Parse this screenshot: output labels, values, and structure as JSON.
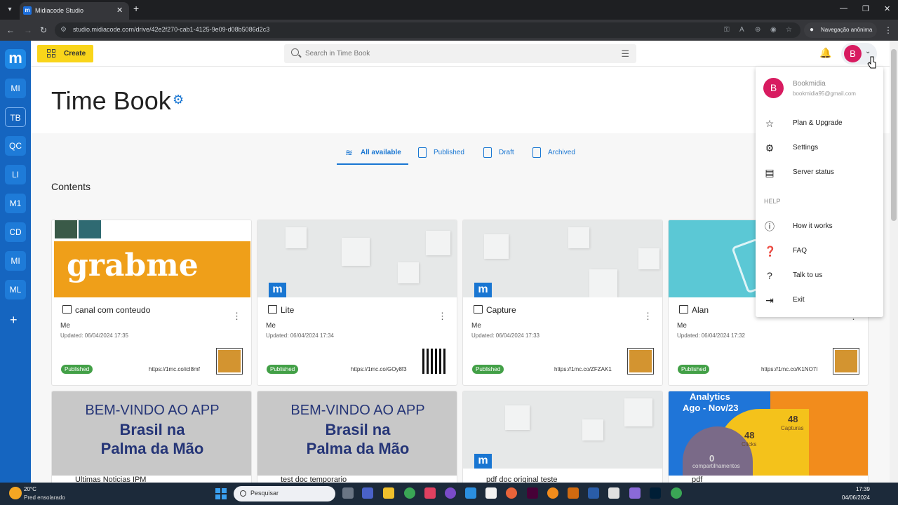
{
  "browser": {
    "tab_title": "Midiacode Studio",
    "url": "studio.midiacode.com/drive/42e2f270-cab1-4125-9e09-d08b5086d2c3",
    "incognito_label": "Navegação anônima"
  },
  "rail": {
    "logo": "m",
    "workspaces": [
      "MI",
      "TB",
      "QC",
      "LI",
      "M1",
      "CD",
      "MI",
      "ML"
    ],
    "add": "+"
  },
  "header": {
    "create_label": "Create",
    "search_placeholder": "Search in Time Book",
    "avatar_letter": "B"
  },
  "page": {
    "title": "Time Book",
    "tabs": [
      "All available",
      "Published",
      "Draft",
      "Archived"
    ],
    "contents_label": "Contents"
  },
  "cards": [
    {
      "title": "canal com conteudo",
      "owner": "Me",
      "updated": "Updated: 06/04/2024 17:35",
      "status": "Published",
      "link": "https://1mc.co/icl8mf",
      "thumb_text": "grabme"
    },
    {
      "title": "Lite",
      "owner": "Me",
      "updated": "Updated: 06/04/2024 17:34",
      "status": "Published",
      "link": "https://1mc.co/GOy8f3"
    },
    {
      "title": "Capture",
      "owner": "Me",
      "updated": "Updated: 06/04/2024 17:33",
      "status": "Published",
      "link": "https://1mc.co/ZFZAK1"
    },
    {
      "title": "Alan",
      "owner": "Me",
      "updated": "Updated: 06/04/2024 17:32",
      "status": "Published",
      "link": "https://1mc.co/K1NO7I"
    }
  ],
  "cards_row2": [
    {
      "title": "Ultimas Noticias IPM",
      "welcome": [
        "BEM-VINDO AO APP",
        "Brasil na",
        "Palma da Mão"
      ]
    },
    {
      "title": "test doc temporario",
      "welcome": [
        "BEM-VINDO AO APP",
        "Brasil na",
        "Palma da Mão"
      ]
    },
    {
      "title": "pdf doc original teste"
    },
    {
      "title": "pdf",
      "analytics": {
        "title1": "Analytics",
        "title2": "Ago - Nov/23",
        "n1": "48",
        "l1": "Capturas",
        "n2": "48",
        "l2": "Clicks",
        "n3": "0",
        "l3": "compartilhamentos"
      }
    }
  ],
  "menu": {
    "name": "Bookmidia",
    "email": "bookmidia95@gmail.com",
    "items": [
      "Plan & Upgrade",
      "Settings",
      "Server status"
    ],
    "help_label": "HELP",
    "help_items": [
      "How it works",
      "FAQ",
      "Talk to us",
      "Exit"
    ]
  },
  "taskbar": {
    "temp": "20°C",
    "condition": "Pred ensolarado",
    "search": "Pesquisar",
    "time": "17:39",
    "date": "04/06/2024"
  },
  "colors": {
    "brand": "#1565c0",
    "create": "#f9d51a",
    "published": "#43a047",
    "avatar": "#d81b60"
  }
}
